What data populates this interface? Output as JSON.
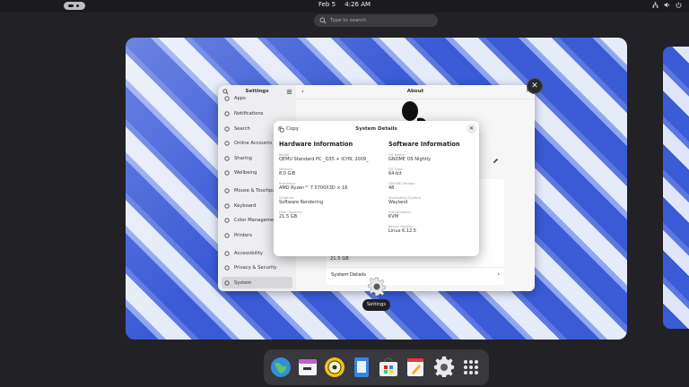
{
  "topbar": {
    "date": "Feb 5",
    "time": "4:26 AM",
    "tray_icons": [
      "network-icon",
      "volume-icon",
      "power-icon"
    ]
  },
  "search": {
    "placeholder": "Type to search"
  },
  "sidebar": {
    "title": "Settings",
    "items": [
      {
        "label": "Apps",
        "icon": "apps-icon"
      },
      {
        "label": "Notifications",
        "icon": "bell-icon"
      },
      {
        "label": "Search",
        "icon": "search-icon"
      },
      {
        "label": "Online Accounts",
        "icon": "cloud-icon"
      },
      {
        "label": "Sharing",
        "icon": "share-icon"
      },
      {
        "label": "Wellbeing",
        "icon": "heart-icon"
      },
      {
        "label": "Mouse & Touchpad",
        "icon": "mouse-icon"
      },
      {
        "label": "Keyboard",
        "icon": "keyboard-icon"
      },
      {
        "label": "Color Management",
        "icon": "palette-icon"
      },
      {
        "label": "Printers",
        "icon": "printer-icon"
      },
      {
        "label": "Accessibility",
        "icon": "accessibility-icon"
      },
      {
        "label": "Privacy & Security",
        "icon": "shield-icon"
      },
      {
        "label": "System",
        "icon": "system-icon"
      }
    ]
  },
  "main": {
    "title": "About",
    "memory_bottom": "21.5 GB",
    "system_details_label": "System Details"
  },
  "dialog": {
    "copy_label": "Copy",
    "title": "System Details",
    "hardware": {
      "heading": "Hardware Information",
      "fields": [
        {
          "key": "Model",
          "value": "QEMU Standard PC _Q35 + ICH9, 2009_"
        },
        {
          "key": "Memory",
          "value": "8.0 GiB"
        },
        {
          "key": "Processor",
          "value": "AMD Ryzen™ 7 5700X3D × 16"
        },
        {
          "key": "Graphics",
          "value": "Software Rendering"
        },
        {
          "key": "Disk Capacity",
          "value": "21.5 GB"
        }
      ]
    },
    "software": {
      "heading": "Software Information",
      "fields": [
        {
          "key": "OS Name",
          "value": "GNOME OS Nightly"
        },
        {
          "key": "OS Type",
          "value": "64-bit"
        },
        {
          "key": "GNOME Version",
          "value": "48"
        },
        {
          "key": "Windowing System",
          "value": "Wayland"
        },
        {
          "key": "Virtualization",
          "value": "KVM"
        },
        {
          "key": "Kernel Version",
          "value": "Linux 6.12.5"
        }
      ]
    }
  },
  "window_label": "Settings",
  "dock": {
    "apps": [
      "web-browser-icon",
      "calendar-icon",
      "disk-icon",
      "text-editor-icon",
      "software-store-icon",
      "notes-icon",
      "settings-gear-icon",
      "app-grid-icon"
    ]
  },
  "colors": {
    "accent": "#3584e4",
    "panel": "#1b1b1e",
    "dock": "#38383d"
  }
}
